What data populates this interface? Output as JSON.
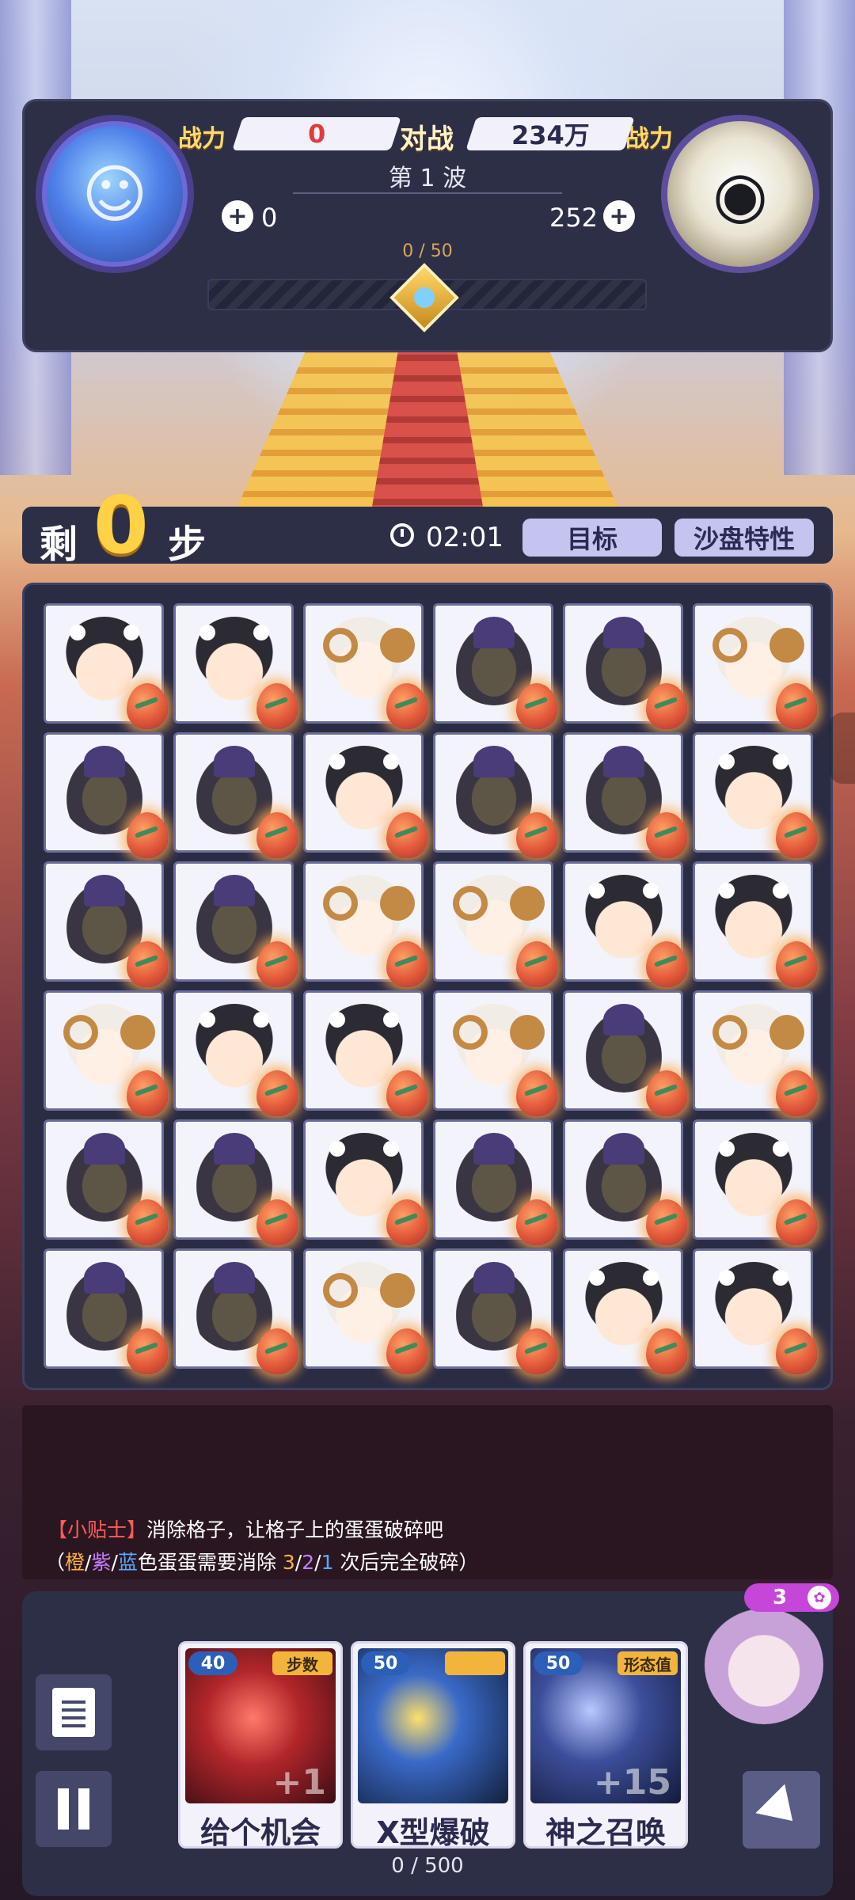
{
  "battle": {
    "power_label_left": "战力",
    "power_value_left": "0",
    "vs_label": "对战",
    "power_value_right": "234万",
    "power_label_right": "战力",
    "wave": "第 1 波",
    "left_score": "0",
    "right_score": "252",
    "progress_text": "0 / 50",
    "progress_fraction": 0
  },
  "steps": {
    "remain_label": "剩",
    "count": "0",
    "unit": "步",
    "timer": "02:01",
    "goal_button": "目标",
    "trait_button": "沙盘特性"
  },
  "board": {
    "rows": [
      [
        "girl",
        "girl",
        "sheep",
        "helm",
        "helm",
        "sheep"
      ],
      [
        "helm",
        "helm",
        "girl",
        "helm",
        "helm",
        "girl"
      ],
      [
        "helm",
        "helm",
        "sheep",
        "sheep",
        "girl",
        "girl"
      ],
      [
        "sheep",
        "girl",
        "girl",
        "sheep",
        "helm",
        "sheep"
      ],
      [
        "helm",
        "helm",
        "girl",
        "helm",
        "helm",
        "girl"
      ],
      [
        "helm",
        "helm",
        "sheep",
        "helm",
        "girl",
        "girl"
      ]
    ]
  },
  "tips": {
    "tag": "【小贴士】",
    "line1_text": "消除格子，让格子上的蛋蛋破碎吧",
    "line2_open": "（",
    "line2_orange": "橙",
    "line2_slash1": "/",
    "line2_purple": "紫",
    "line2_slash2": "/",
    "line2_blue": "蓝",
    "line2_mid": "色蛋蛋需要消除 ",
    "line2_n3": "3",
    "line2_slash3": "/",
    "line2_n2": "2",
    "line2_slash4": "/",
    "line2_n1": "1",
    "line2_end": " 次后完全破碎）"
  },
  "skills": [
    {
      "cost": "40",
      "tag": "步数",
      "name": "给个机会",
      "plus": "+1"
    },
    {
      "cost": "50",
      "tag": "",
      "name": "X型爆破",
      "plus": ""
    },
    {
      "cost": "50",
      "tag": "形态值",
      "name": "神之召唤",
      "plus": "+15"
    }
  ],
  "energy": "0 / 500",
  "pet": {
    "count": "3"
  },
  "icons": {
    "doc": "document-icon",
    "pause": "pause-icon",
    "arrow": "arrow-down-right-icon",
    "timer": "timer-icon",
    "cross": "plus-circle-icon"
  }
}
